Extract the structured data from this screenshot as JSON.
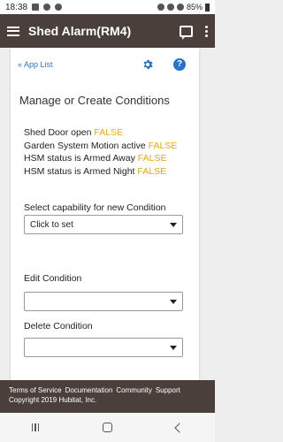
{
  "status_bar": {
    "time": "18:38",
    "battery": "85%"
  },
  "app_bar": {
    "title": "Shed Alarm(RM4)"
  },
  "card": {
    "app_list_link": "« App List",
    "section_title": "Manage or Create Conditions",
    "conditions": [
      {
        "text": "Shed Door open",
        "state": "FALSE"
      },
      {
        "text": "Garden System Motion active",
        "state": "FALSE"
      },
      {
        "text": "HSM status is Armed Away",
        "state": "FALSE"
      },
      {
        "text": "HSM status is Armed Night",
        "state": "FALSE"
      }
    ],
    "select_capability": {
      "label": "Select capability for new Condition",
      "value": "Click to set"
    },
    "edit_condition": {
      "label": "Edit Condition",
      "value": ""
    },
    "delete_condition": {
      "label": "Delete Condition",
      "value": ""
    }
  },
  "footer": {
    "links": [
      "Terms of Service",
      "Documentation",
      "Community",
      "Support"
    ],
    "copyright": "Copyright 2019 Hubitat, Inc."
  },
  "colors": {
    "app_bar": "#4a3f3b",
    "link": "#2873c7",
    "false_state": "#e5a71a"
  }
}
